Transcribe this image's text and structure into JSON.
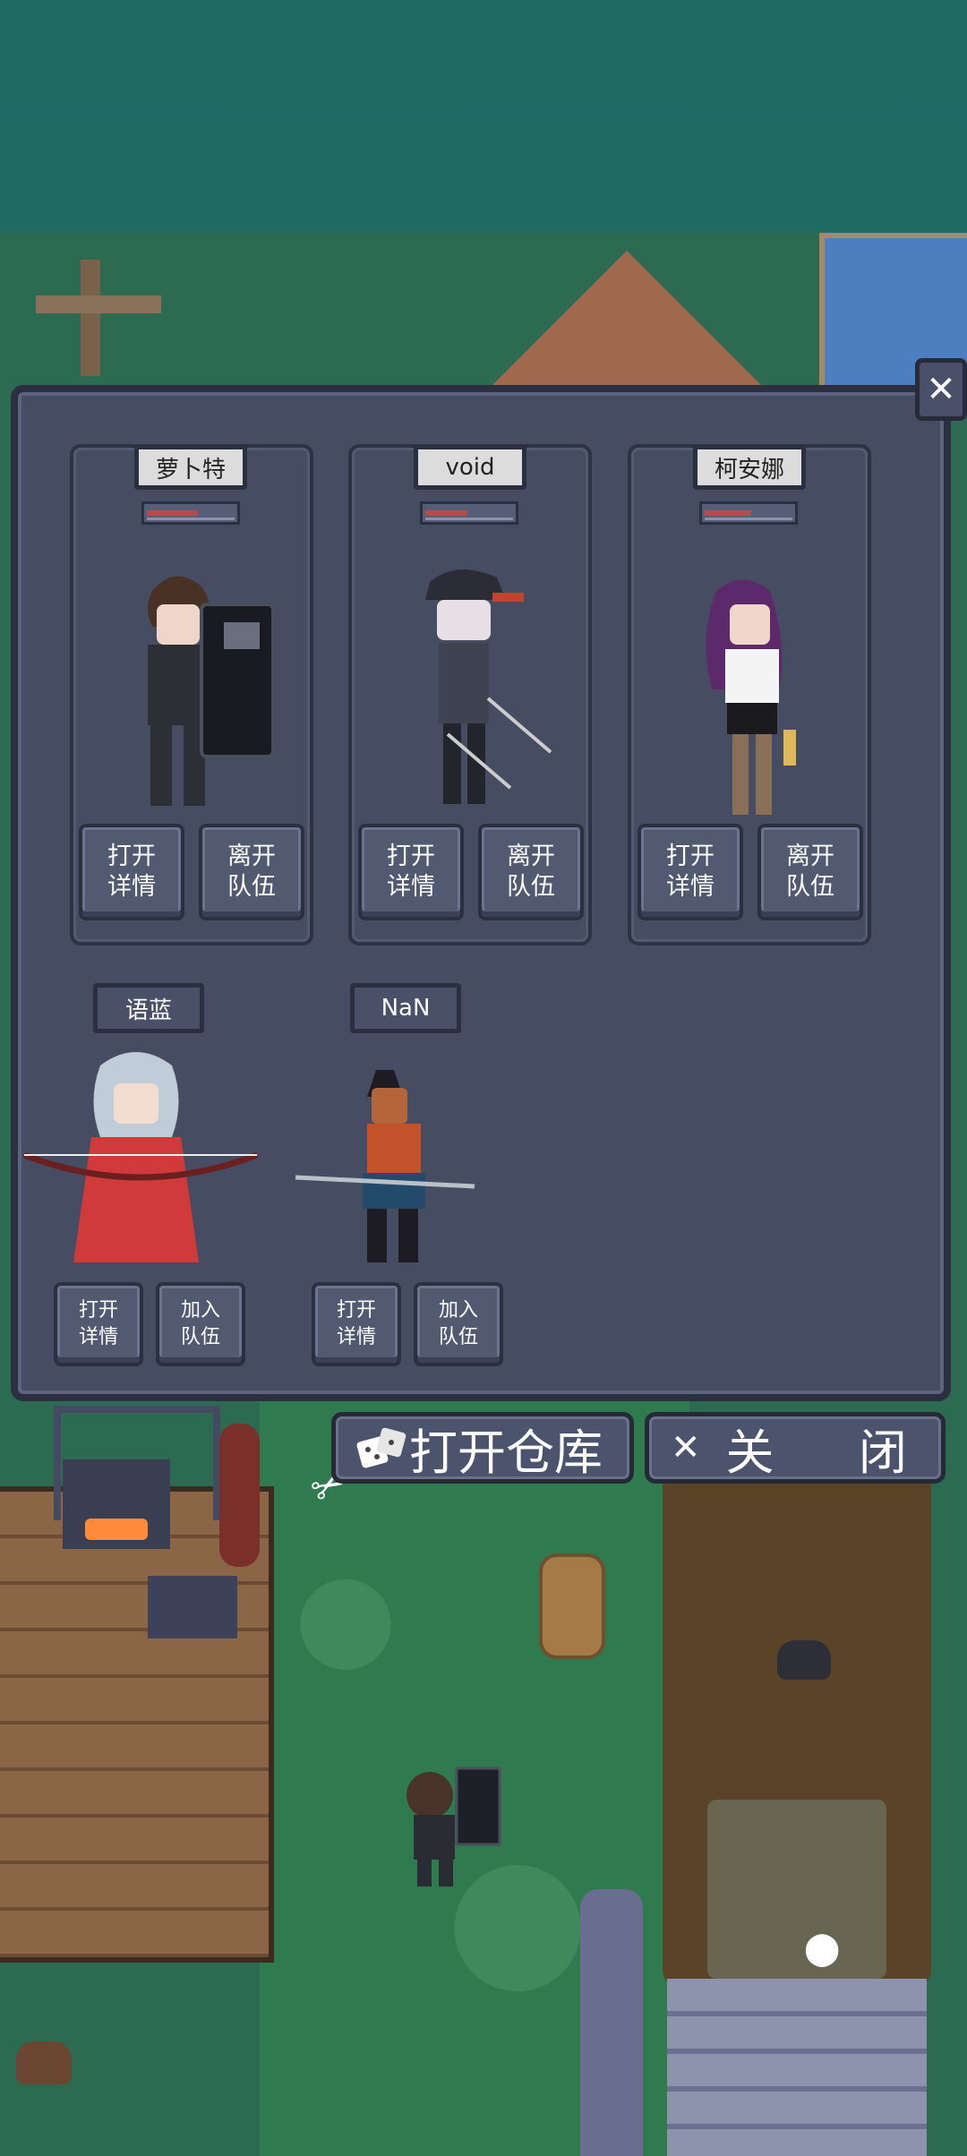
{
  "party": {
    "members": [
      {
        "name": "萝卜特",
        "hp": 0.55,
        "open_label_1": "打开",
        "open_label_2": "详情",
        "leave_label_1": "离开",
        "leave_label_2": "队伍"
      },
      {
        "name": "void",
        "hp": 0.45,
        "open_label_1": "打开",
        "open_label_2": "详情",
        "leave_label_1": "离开",
        "leave_label_2": "队伍"
      },
      {
        "name": "柯安娜",
        "hp": 0.5,
        "open_label_1": "打开",
        "open_label_2": "详情",
        "leave_label_1": "离开",
        "leave_label_2": "队伍"
      }
    ],
    "reserves": [
      {
        "name": "语蓝",
        "open_label_1": "打开",
        "open_label_2": "详情",
        "join_label_1": "加入",
        "join_label_2": "队伍"
      },
      {
        "name": "NaN",
        "open_label_1": "打开",
        "open_label_2": "详情",
        "join_label_1": "加入",
        "join_label_2": "队伍"
      }
    ]
  },
  "panel_close_icon": "✕",
  "bottom": {
    "warehouse_label": "打开仓库",
    "warehouse_icon": "dice-icon",
    "close_label": "关  闭",
    "close_icon": "✕"
  },
  "colors": {
    "panel": "#464d63",
    "border": "#2b3040",
    "hp": "#b84a4a"
  }
}
